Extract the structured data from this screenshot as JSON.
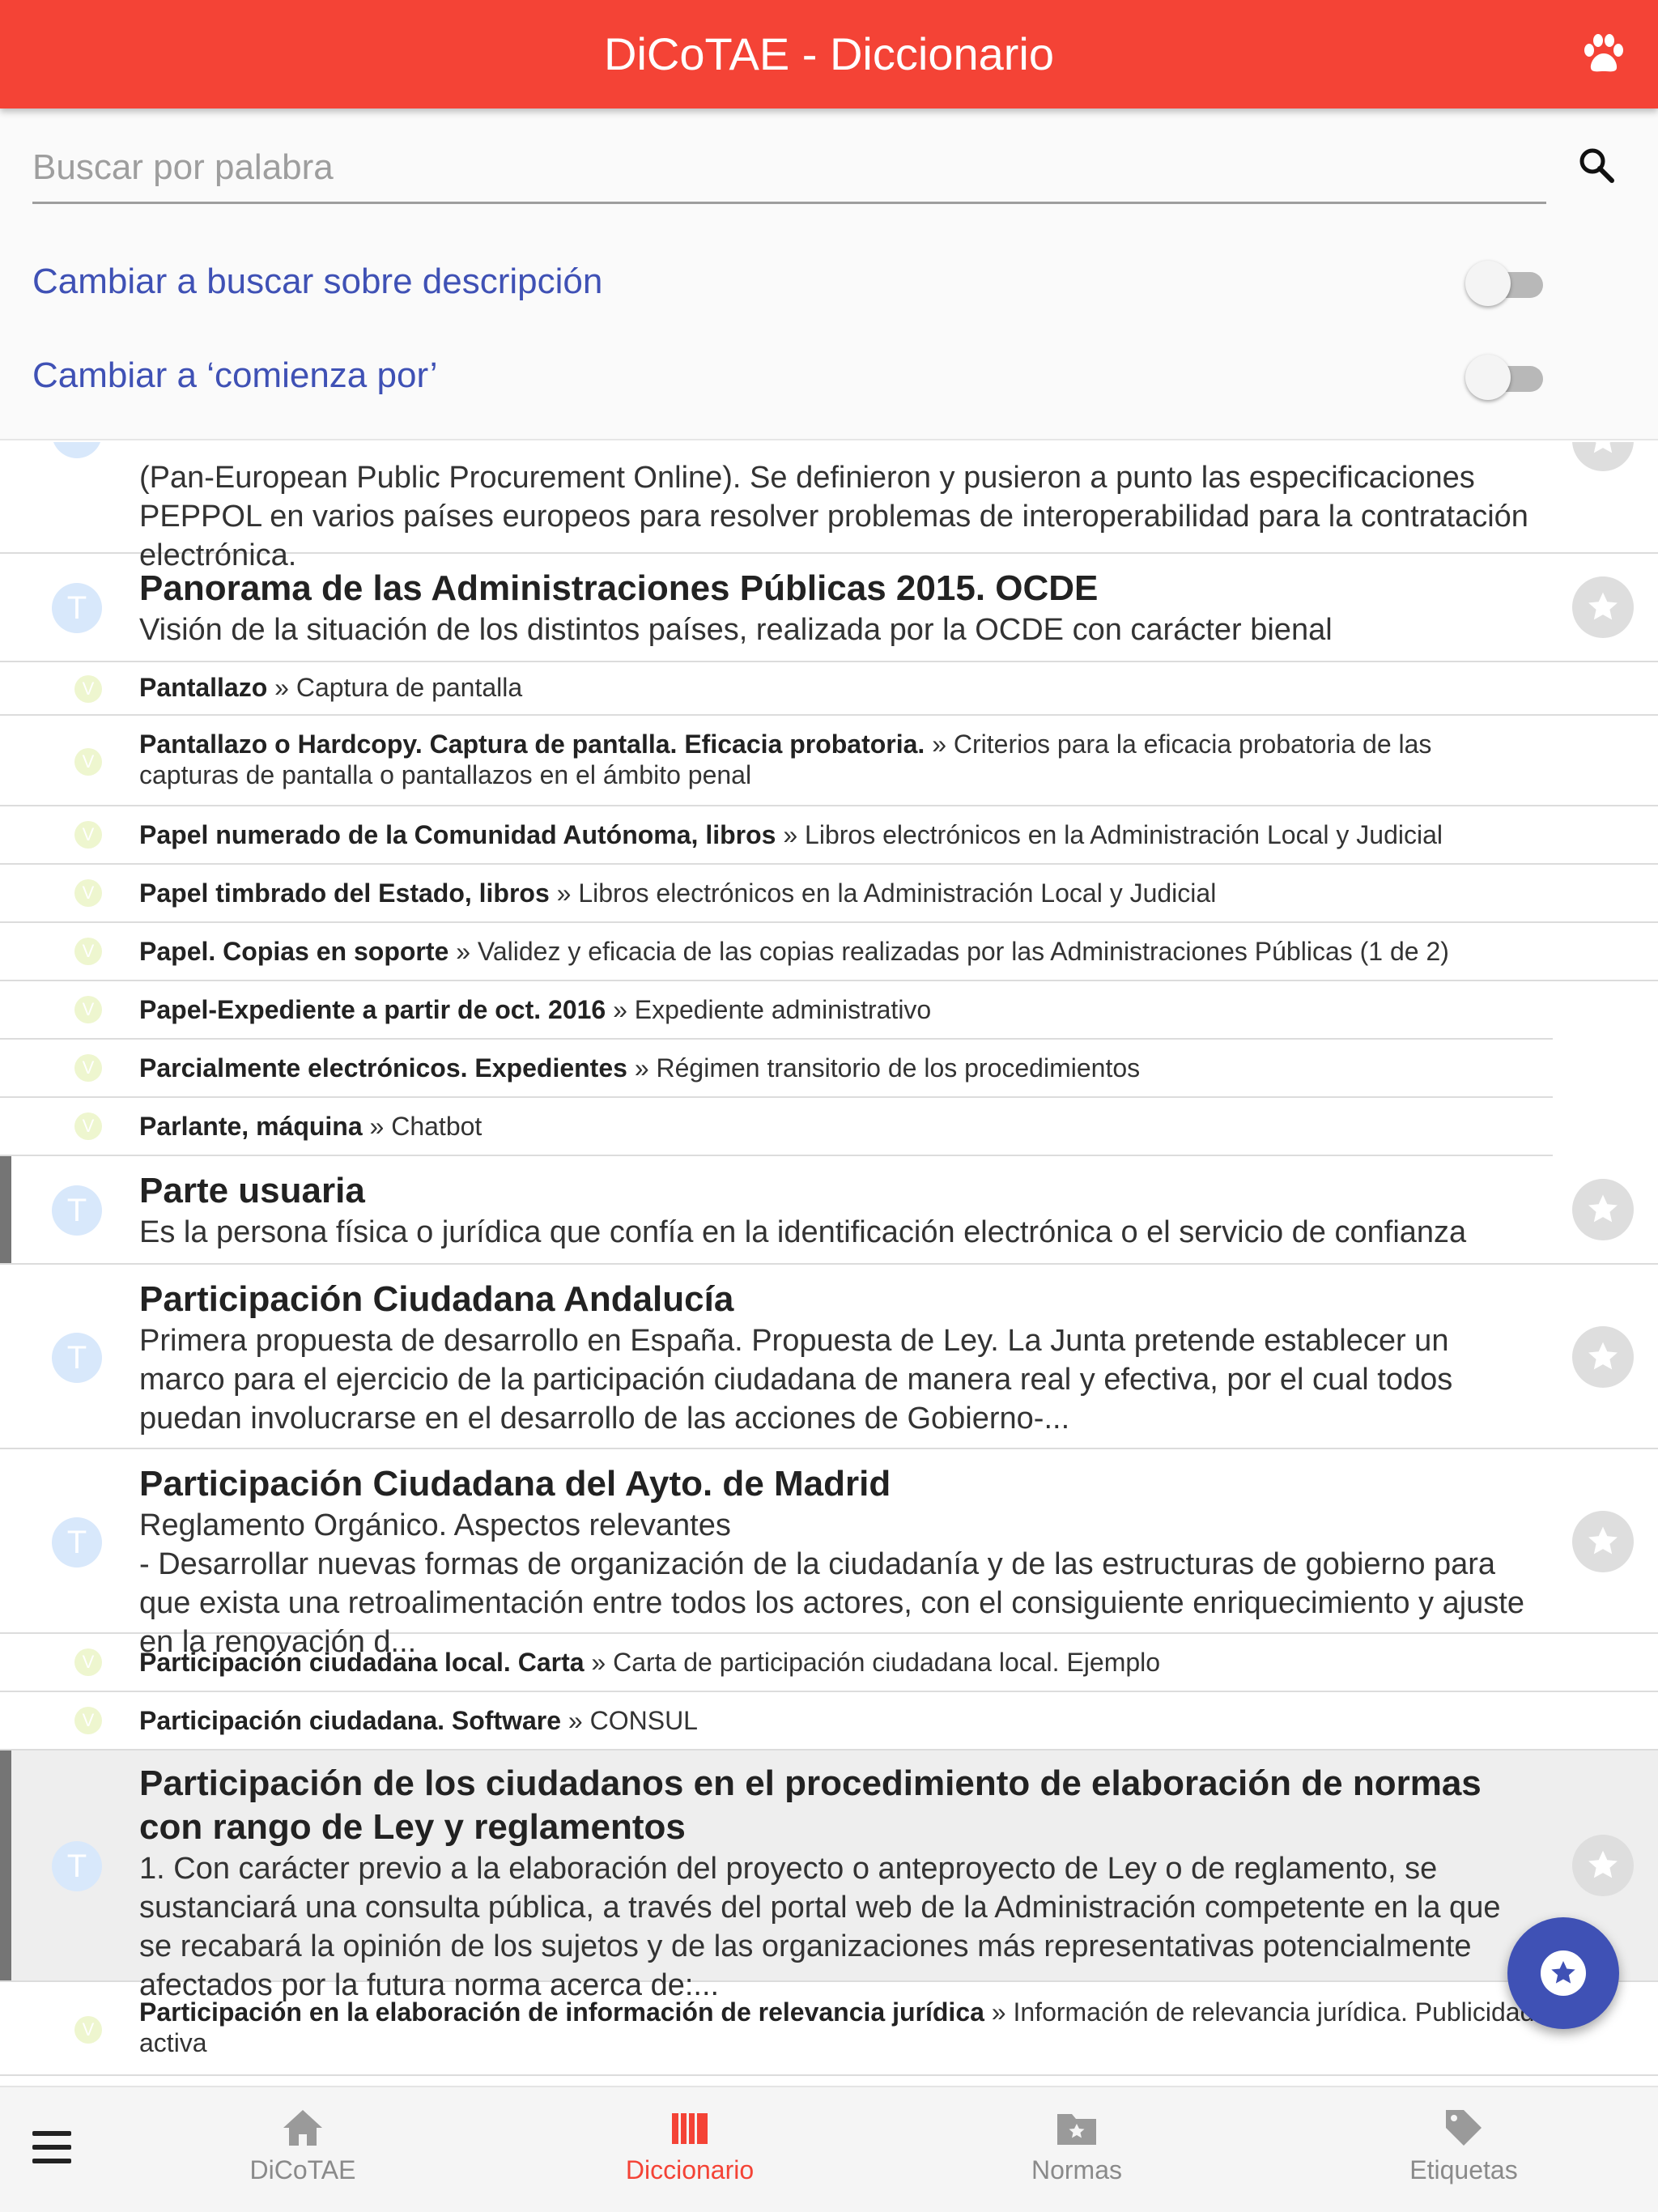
{
  "header": {
    "title": "DiCoTAE - Diccionario"
  },
  "search": {
    "placeholder": "Buscar por palabra"
  },
  "toggles": [
    {
      "label": "Cambiar a buscar sobre descripción",
      "on": false
    },
    {
      "label": "Cambiar a ‘comienza por’",
      "on": false
    }
  ],
  "icons": {
    "type_t": "T",
    "type_v": "V"
  },
  "list": {
    "partial_row": {
      "desc": "(Pan-European Public Procurement Online). Se definieron y pusieron a punto las especificaciones PEPPOL en varios países europeos para resolver problemas de interoperabilidad para la contratación electrónica."
    },
    "item1": {
      "title": "Panorama de las Administraciones Públicas 2015. OCDE",
      "desc": "Visión de la situación de los distintos países, realizada por la OCDE con carácter bienal"
    },
    "links": [
      {
        "term": "Pantallazo",
        "target": "Captura de pantalla"
      },
      {
        "term": "Pantallazo o Hardcopy. Captura de pantalla. Eficacia probatoria.",
        "target": "Criterios para la eficacia probatoria de las capturas de pantalla o pantallazos en el ámbito penal"
      },
      {
        "term": "Papel numerado de la Comunidad Autónoma, libros",
        "target": "Libros electrónicos en la Administración Local y Judicial"
      },
      {
        "term": "Papel timbrado del Estado, libros",
        "target": "Libros electrónicos en la Administración Local y Judicial"
      },
      {
        "term": "Papel. Copias en soporte",
        "target": "Validez y eficacia de las copias realizadas por las Administraciones Públicas (1 de 2)"
      },
      {
        "term": "Papel-Expediente a partir de oct. 2016",
        "target": "Expediente administrativo"
      },
      {
        "term": "Parcialmente electrónicos. Expedientes",
        "target": "Régimen transitorio de los procedimientos"
      },
      {
        "term": "Parlante, máquina",
        "target": "Chatbot"
      }
    ],
    "item2": {
      "title": "Parte usuaria",
      "desc": "Es la persona física o jurídica que confía en la identificación electrónica o el servicio de confianza"
    },
    "item3": {
      "title": "Participación Ciudadana Andalucía",
      "desc": "Primera propuesta de desarrollo en España. Propuesta de Ley. La Junta pretende establecer un marco para el ejercicio de la participación ciudadana de manera real y efectiva, por el cual todos puedan involucrarse en el desarrollo de las acciones de Gobierno-..."
    },
    "item4": {
      "title": "Participación Ciudadana del Ayto. de Madrid",
      "desc1": "Reglamento Orgánico. Aspectos relevantes",
      "desc2": "- Desarrollar nuevas formas de organización de la ciudadanía y de las estructuras de gobierno para que exista una retroalimentación entre todos los actores, con el consiguiente enriquecimiento y ajuste en la renovación d..."
    },
    "links2": [
      {
        "term": "Participación ciudadana local. Carta",
        "target": "Carta de participación ciudadana local. Ejemplo"
      },
      {
        "term": "Participación ciudadana. Software",
        "target": "CONSUL"
      }
    ],
    "item5": {
      "title": "Participación de los ciudadanos en el procedimiento de elaboración de normas con rango de Ley y reglamentos",
      "desc": "1. Con carácter previo a la elaboración del proyecto o anteproyecto de Ley o de reglamento, se sustanciará una consulta pública, a través del portal web de la Administración competente en la que se recabará la opinión de los sujetos y de las organizaciones más representativas potencialmente afectados por la futura norma acerca de:..."
    },
    "link_last": {
      "term": "Participación en la elaboración de información de relevancia jurídica",
      "target": "Información de relevancia jurídica. Publicidad activa"
    },
    "separator": "»"
  },
  "bottom_nav": {
    "items": [
      {
        "label": "DiCoTAE",
        "icon": "home-icon"
      },
      {
        "label": "Diccionario",
        "icon": "book-icon"
      },
      {
        "label": "Normas",
        "icon": "folder-star-icon"
      },
      {
        "label": "Etiquetas",
        "icon": "tag-icon"
      }
    ],
    "active": "Diccionario"
  },
  "colors": {
    "primary": "#f44336",
    "accent": "#3f51b5",
    "link_text": "#3f51b5"
  }
}
